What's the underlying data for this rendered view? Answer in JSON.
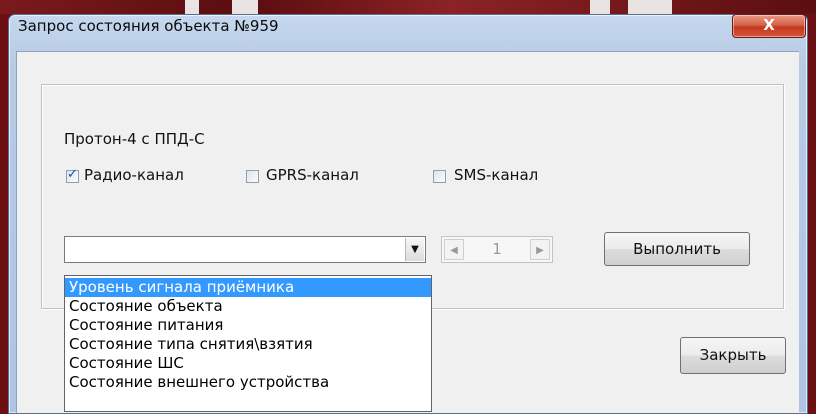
{
  "window": {
    "title": "Запрос состояния объекта №959",
    "close_glyph": "X"
  },
  "device_label": "Протон-4 с ППД-С",
  "channels": [
    {
      "label": "Радио-канал",
      "checked": true
    },
    {
      "label": "GPRS-канал",
      "checked": false
    },
    {
      "label": "SMS-канал",
      "checked": false
    }
  ],
  "command_combo": {
    "value": "",
    "options": [
      "Уровень сигнала приёмника",
      "Состояние объекта",
      "Состояние питания",
      "Состояние типа снятия\\взятия",
      "Состояние ШС",
      "Состояние внешнего устройства"
    ],
    "highlighted_index": 0
  },
  "pager": {
    "value": "1"
  },
  "buttons": {
    "execute": "Выполнить",
    "close": "Закрыть"
  },
  "colors": {
    "selection": "#3399ff",
    "close_button": "#c3391f",
    "frame": "#b7cbe5"
  }
}
